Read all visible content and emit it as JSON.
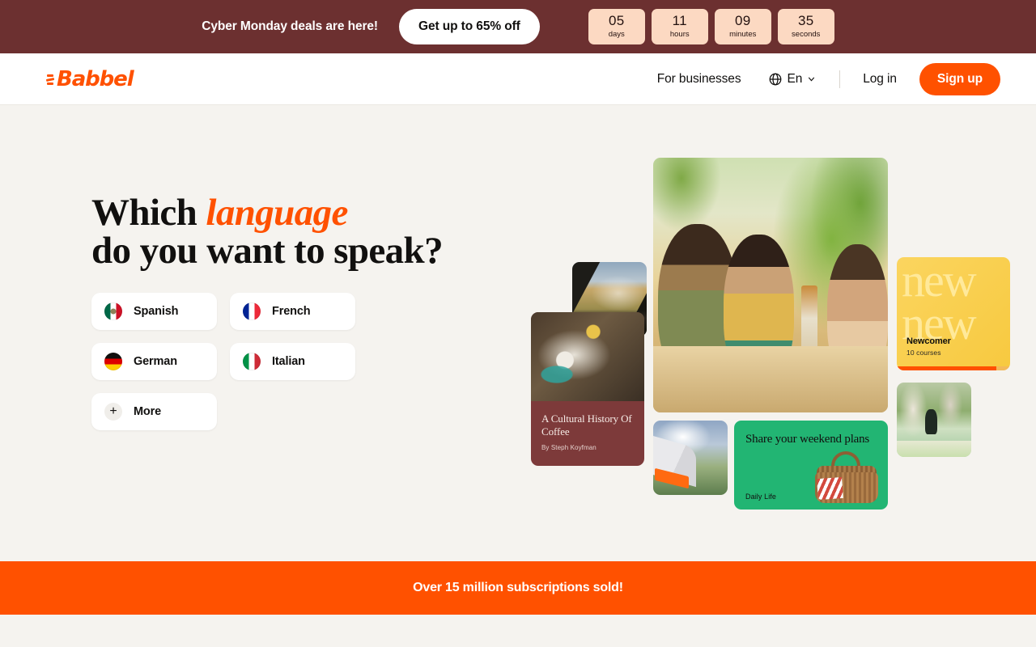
{
  "promo_bar": {
    "message": "Cyber Monday deals are here!",
    "cta_label": "Get up to 65% off",
    "background_color": "#6c3030",
    "countdown": [
      {
        "value": "05",
        "unit": "days"
      },
      {
        "value": "11",
        "unit": "hours"
      },
      {
        "value": "09",
        "unit": "minutes"
      },
      {
        "value": "35",
        "unit": "seconds"
      }
    ]
  },
  "header": {
    "logo_text": "Babbel",
    "logo_color": "#ff5100",
    "for_businesses": "For businesses",
    "language": "En",
    "login": "Log in",
    "signup": "Sign up",
    "signup_color": "#ff5100"
  },
  "hero": {
    "title_part1": "Which ",
    "title_accent": "language",
    "title_part2": "do you want to speak?",
    "accent_color": "#ff5100",
    "languages": [
      {
        "label": "Spanish",
        "flag": "flag-mexico-icon"
      },
      {
        "label": "French",
        "flag": "flag-france-icon"
      },
      {
        "label": "German",
        "flag": "flag-germany-icon"
      },
      {
        "label": "Italian",
        "flag": "flag-italy-icon"
      },
      {
        "label": "More",
        "flag": "plus-icon"
      }
    ]
  },
  "collage": {
    "coffee_card": {
      "title": "A Cultural History Of Coffee",
      "byline": "By Steph Koyfman",
      "background_color": "#7d3a3a"
    },
    "weekend_card": {
      "title": "Share your weekend plans",
      "category": "Daily Life",
      "background_color": "#22b573"
    },
    "newcomer_card": {
      "watermark": "new new",
      "name": "Newcomer",
      "courses": "10 courses",
      "background_color": "#fbd55f",
      "progress_color": "#ff5100"
    }
  },
  "bottom_banner": {
    "text": "Over 15 million subscriptions sold!",
    "background_color": "#ff5100"
  }
}
